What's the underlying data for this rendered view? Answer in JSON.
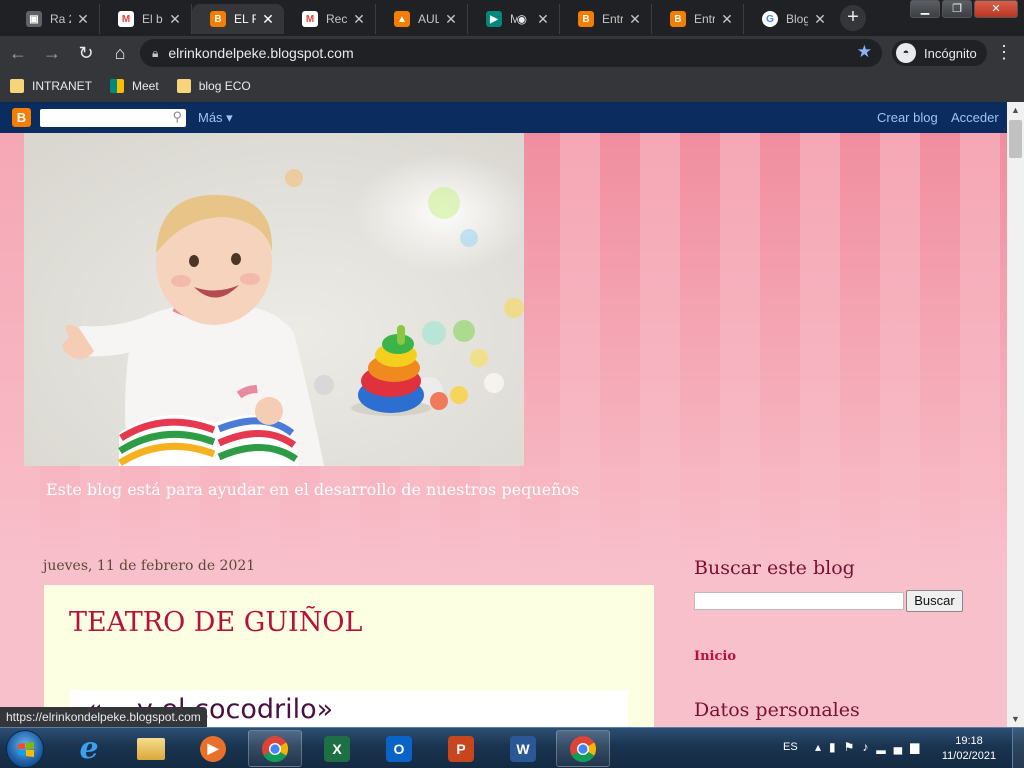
{
  "browser": {
    "tabs": [
      {
        "label": "Ra 2",
        "favicon": "classroom-icon",
        "color": "#5f6368",
        "active": false
      },
      {
        "label": "El blo",
        "favicon": "gmail-icon",
        "color": "#ea4335",
        "active": false
      },
      {
        "label": "EL RIN",
        "favicon": "blogger-icon",
        "color": "#f57d00",
        "active": true
      },
      {
        "label": "Recib",
        "favicon": "gmail-icon",
        "color": "#ea4335",
        "active": false
      },
      {
        "label": "AULA",
        "favicon": "classroom-icon",
        "color": "#f57d00",
        "active": false
      },
      {
        "label": "M",
        "favicon": "meet-icon",
        "color": "#00897b",
        "active": false
      },
      {
        "label": "Entra",
        "favicon": "blogger-icon",
        "color": "#f57d00",
        "active": false
      },
      {
        "label": "Entra",
        "favicon": "blogger-icon",
        "color": "#f57d00",
        "active": false
      },
      {
        "label": "Blogg",
        "favicon": "google-icon",
        "color": "#4285f4",
        "active": false
      }
    ],
    "url": "elrinkondelpeke.blogspot.com",
    "incognito_label": "Incógnito",
    "bookmarks": [
      {
        "label": "INTRANET",
        "icon": "folder-icon"
      },
      {
        "label": "Meet",
        "icon": "meet-icon"
      },
      {
        "label": "blog ECO",
        "icon": "folder-icon"
      }
    ]
  },
  "blogger_bar": {
    "more_label": "Más",
    "create_blog": "Crear blog",
    "sign_in": "Acceder"
  },
  "blog": {
    "description": "Este blog está para ayudar en el desarrollo de nuestros pequeños",
    "post": {
      "date": "jueves, 11 de febrero de 2021",
      "title": "TEATRO DE GUIÑOL",
      "body_text": "«... y el cocodrilo»"
    },
    "sidebar": {
      "search_title": "Buscar este blog",
      "search_button": "Buscar",
      "home_link": "Inicio",
      "profile_title": "Datos personales"
    }
  },
  "status_url": "https://elrinkondelpeke.blogspot.com",
  "taskbar": {
    "language": "ES",
    "time": "19:18",
    "date": "11/02/2021",
    "apps": [
      {
        "name": "internet-explorer-icon",
        "color": "#1e90ff",
        "glyph": "e"
      },
      {
        "name": "file-explorer-icon",
        "color": "#e8b84a",
        "glyph": "▤"
      },
      {
        "name": "media-player-icon",
        "color": "#e8702a",
        "glyph": "▶"
      },
      {
        "name": "chrome-icon",
        "color": "#4285f4",
        "glyph": "●"
      },
      {
        "name": "excel-icon",
        "color": "#1d7044",
        "glyph": "X"
      },
      {
        "name": "outlook-icon",
        "color": "#0a64c8",
        "glyph": "O"
      },
      {
        "name": "powerpoint-icon",
        "color": "#c8461e",
        "glyph": "P"
      },
      {
        "name": "word-icon",
        "color": "#2b5797",
        "glyph": "W"
      },
      {
        "name": "chrome-icon",
        "color": "#4285f4",
        "glyph": "●"
      }
    ]
  }
}
